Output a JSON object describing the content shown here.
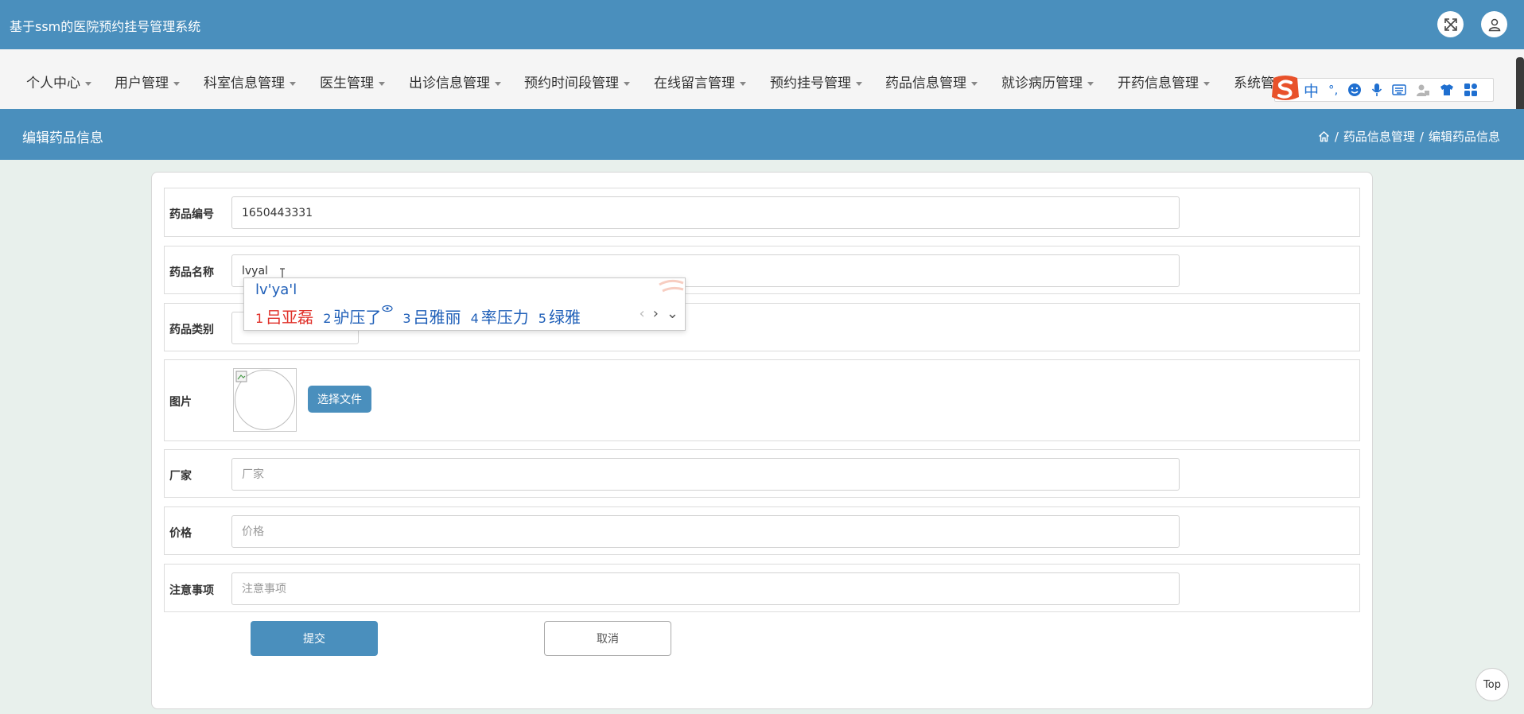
{
  "app": {
    "title": "基于ssm的医院预约挂号管理系统"
  },
  "nav": {
    "items": [
      {
        "label": "个人中心"
      },
      {
        "label": "用户管理"
      },
      {
        "label": "科室信息管理"
      },
      {
        "label": "医生管理"
      },
      {
        "label": "出诊信息管理"
      },
      {
        "label": "预约时间段管理"
      },
      {
        "label": "在线留言管理"
      },
      {
        "label": "预约挂号管理"
      },
      {
        "label": "药品信息管理"
      },
      {
        "label": "就诊病历管理"
      },
      {
        "label": "开药信息管理"
      },
      {
        "label": "系统管"
      }
    ]
  },
  "ime_bar": {
    "mode": "中",
    "punct": "°,",
    "colors": {
      "logo": "#e8512a",
      "icons": "#1f6fd0"
    }
  },
  "page": {
    "title": "编辑药品信息",
    "breadcrumb": [
      "药品信息管理",
      "/",
      "编辑药品信息"
    ]
  },
  "form": {
    "code": {
      "label": "药品编号",
      "value": "1650443331"
    },
    "name": {
      "label": "药品名称",
      "value": "lvyal"
    },
    "category": {
      "label": "药品类别"
    },
    "image": {
      "label": "图片",
      "button": "选择文件"
    },
    "maker": {
      "label": "厂家",
      "placeholder": "厂家"
    },
    "price": {
      "label": "价格",
      "placeholder": "价格"
    },
    "notes": {
      "label": "注意事项",
      "placeholder": "注意事项"
    },
    "submit": "提交",
    "cancel": "取消"
  },
  "ime_popup": {
    "composition": "lv'ya'l",
    "candidates": [
      {
        "num": "1",
        "text": "吕亚磊"
      },
      {
        "num": "2",
        "text": "驴压了"
      },
      {
        "num": "3",
        "text": "吕雅丽"
      },
      {
        "num": "4",
        "text": "率压力"
      },
      {
        "num": "5",
        "text": "绿雅"
      }
    ]
  },
  "back_to_top": "Top",
  "colors": {
    "primary": "#4a8fbd",
    "nav_bg": "#f5f5f5",
    "page_bg": "#e8f0ec"
  }
}
